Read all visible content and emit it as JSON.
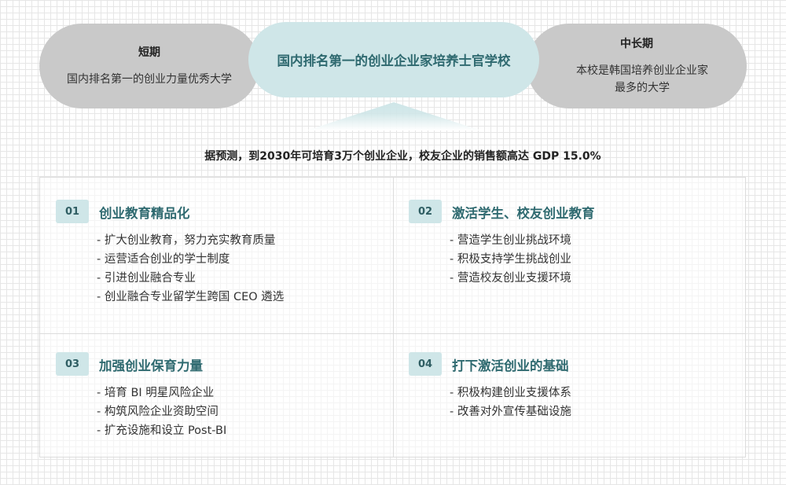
{
  "short_term": {
    "title": "短期",
    "text": "国内排名第一的创业力量优秀大学"
  },
  "center_goal": "国内排名第一的创业企业家培养士官学校",
  "long_term": {
    "title": "中长期",
    "text": "本校是韩国培养创业企业家最多的大学"
  },
  "forecast": "据预测，到2030年可培育3万个创业企业，校友企业的销售额高达 GDP 15.0%",
  "quadrants": [
    {
      "number": "01",
      "title": "创业教育精品化",
      "items": [
        "扩大创业教育，努力充实教育质量",
        "运营适合创业的学士制度",
        "引进创业融合专业",
        "创业融合专业留学生跨国 CEO 遴选"
      ]
    },
    {
      "number": "02",
      "title": "激活学生、校友创业教育",
      "items": [
        "营造学生创业挑战环境",
        "积极支持学生挑战创业",
        "营造校友创业支援环境"
      ]
    },
    {
      "number": "03",
      "title": "加强创业保育力量",
      "items": [
        "培育 BI 明星风险企业",
        "构筑风险企业资助空间",
        "扩充设施和设立 Post-BI"
      ]
    },
    {
      "number": "04",
      "title": "打下激活创业的基础",
      "items": [
        "积极构建创业支援体系",
        "改善对外宣传基础设施"
      ]
    }
  ],
  "colors": {
    "accent": "#2f6a70",
    "accent_light": "#cfe6e8",
    "side_pill": "#c9c9c9"
  }
}
